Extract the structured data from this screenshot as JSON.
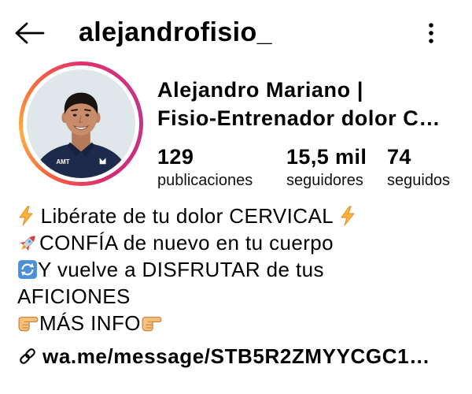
{
  "header": {
    "username": "alejandrofisio_",
    "back_icon": "arrow-left-icon",
    "menu_icon": "more-vertical-icon"
  },
  "profile": {
    "avatar_icon": "profile-photo",
    "shirt_logo_text": "AMT",
    "name_line1": "Alejandro Mariano |",
    "name_line2": "Fisio-Entrenador dolor C…",
    "stats": [
      {
        "value": "129",
        "label": "publicaciones"
      },
      {
        "value": "15,5 mil",
        "label": "seguidores"
      },
      {
        "value": "74",
        "label": "seguidos"
      }
    ]
  },
  "bio": {
    "lines": [
      [
        {
          "icon": "lightning-icon"
        },
        {
          "text": " Libérate de tu dolor CERVICAL "
        },
        {
          "icon": "lightning-icon"
        }
      ],
      [
        {
          "icon": "rocket-icon"
        },
        {
          "text": "CONFÍA de nuevo en tu cuerpo"
        }
      ],
      [
        {
          "icon": "repeat-arrows-icon"
        },
        {
          "text": "Y vuelve a DISFRUTAR de tus"
        }
      ],
      [
        {
          "text": "AFICIONES"
        }
      ],
      [
        {
          "icon": "hand-pointing-right-icon"
        },
        {
          "text": "MÁS INFO"
        },
        {
          "icon": "hand-pointing-right-icon"
        }
      ]
    ],
    "link": {
      "icon": "link-icon",
      "text": "wa.me/message/STB5R2ZMYYCGC1…"
    }
  },
  "colors": {
    "text": "#000000",
    "background": "#ffffff",
    "story_ring": [
      "#fcaf45",
      "#f77737",
      "#e1306c",
      "#c1358a"
    ]
  }
}
